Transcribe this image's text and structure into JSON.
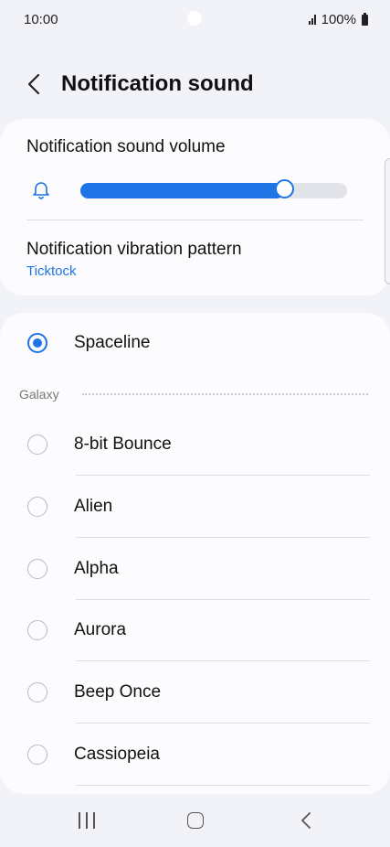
{
  "status_bar": {
    "time": "10:00",
    "battery": "100%"
  },
  "header": {
    "title": "Notification sound"
  },
  "volume": {
    "label": "Notification sound volume",
    "level": 0.73
  },
  "vibration": {
    "label": "Notification vibration pattern",
    "value": "Ticktock"
  },
  "selected_sound": "Spaceline",
  "category": "Galaxy",
  "sounds": [
    "8-bit Bounce",
    "Alien",
    "Alpha",
    "Aurora",
    "Beep Once",
    "Cassiopeia"
  ],
  "colors": {
    "accent": "#1f74e6",
    "background": "#f2f3f8",
    "card": "#fcfcfe"
  },
  "icons": {
    "back": "chevron-left-icon",
    "volume": "bell-icon"
  }
}
